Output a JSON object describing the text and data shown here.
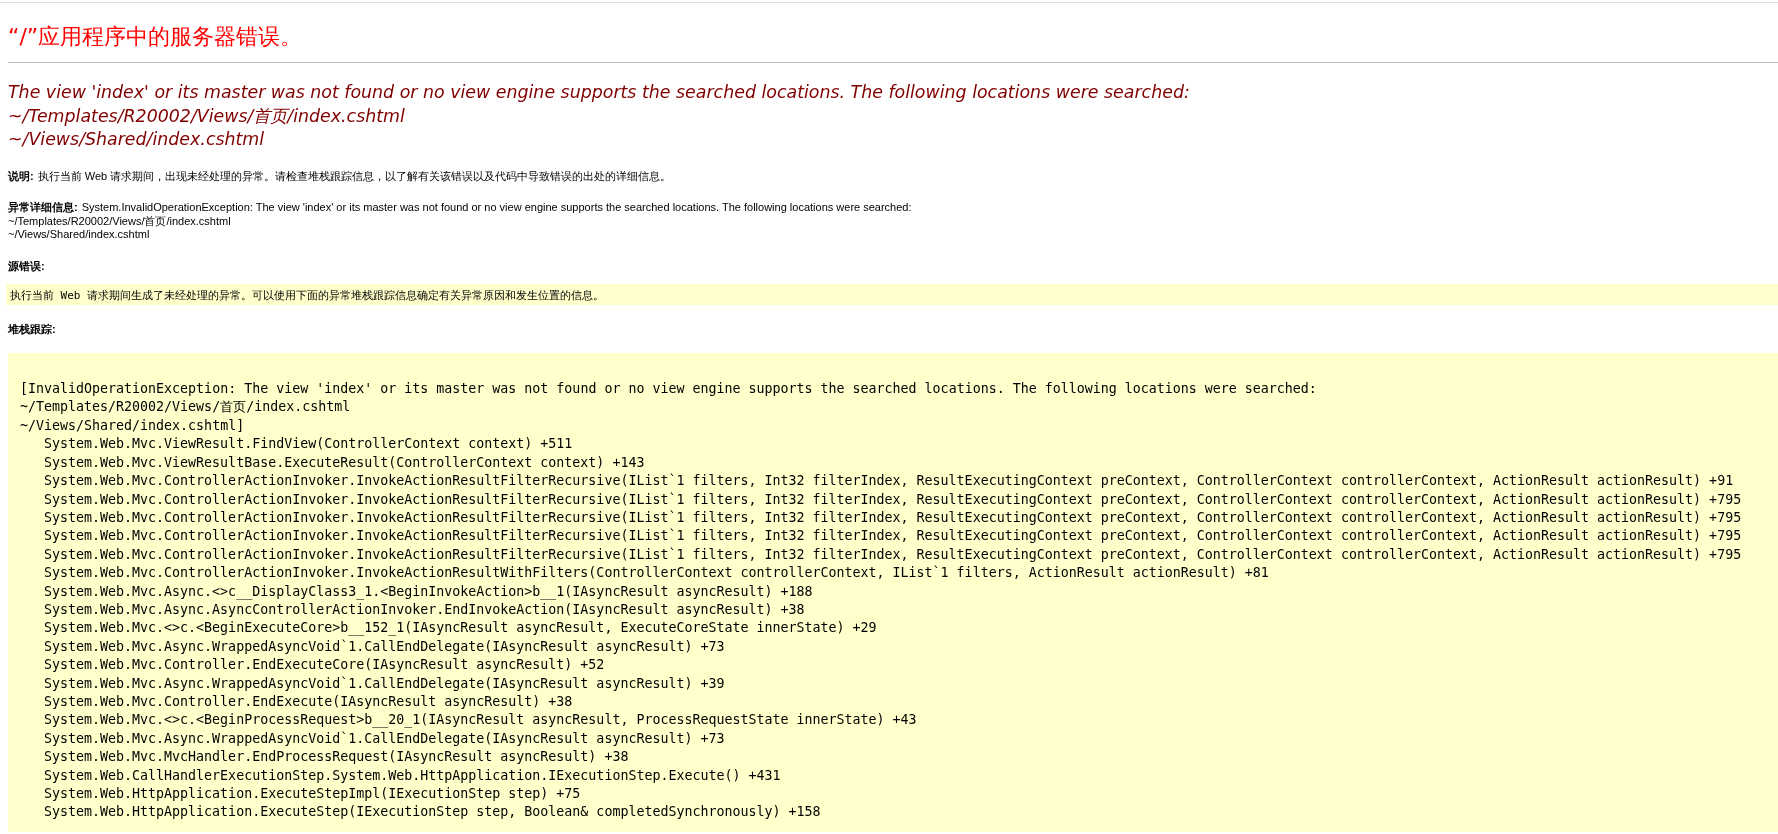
{
  "title": "“/”应用程序中的服务器错误。",
  "error_heading": [
    "The view 'index' or its master was not found or no view engine supports the searched locations. The following locations were searched:",
    "~/Templates/R20002/Views/首页/index.cshtml",
    "~/Views/Shared/index.cshtml"
  ],
  "description": {
    "label": "说明:",
    "text": "执行当前 Web 请求期间，出现未经处理的异常。请检查堆栈跟踪信息，以了解有关该错误以及代码中导致错误的出处的详细信息。"
  },
  "exception_details": {
    "label": "异常详细信息:",
    "lines": [
      "System.InvalidOperationException: The view 'index' or its master was not found or no view engine supports the searched locations. The following locations were searched:",
      "~/Templates/R20002/Views/首页/index.cshtml",
      "~/Views/Shared/index.cshtml"
    ]
  },
  "source_error": {
    "label": "源错误:",
    "text": "执行当前 Web 请求期间生成了未经处理的异常。可以使用下面的异常堆栈跟踪信息确定有关异常原因和发生位置的信息。"
  },
  "stack_trace": {
    "label": "堆栈跟踪:",
    "exception_lines": [
      "[InvalidOperationException: The view 'index' or its master was not found or no view engine supports the searched locations. The following locations were searched:",
      "~/Templates/R20002/Views/首页/index.cshtml",
      "~/Views/Shared/index.cshtml]"
    ],
    "frames": [
      "System.Web.Mvc.ViewResult.FindView(ControllerContext context) +511",
      "System.Web.Mvc.ViewResultBase.ExecuteResult(ControllerContext context) +143",
      "System.Web.Mvc.ControllerActionInvoker.InvokeActionResultFilterRecursive(IList`1 filters, Int32 filterIndex, ResultExecutingContext preContext, ControllerContext controllerContext, ActionResult actionResult) +91",
      "System.Web.Mvc.ControllerActionInvoker.InvokeActionResultFilterRecursive(IList`1 filters, Int32 filterIndex, ResultExecutingContext preContext, ControllerContext controllerContext, ActionResult actionResult) +795",
      "System.Web.Mvc.ControllerActionInvoker.InvokeActionResultFilterRecursive(IList`1 filters, Int32 filterIndex, ResultExecutingContext preContext, ControllerContext controllerContext, ActionResult actionResult) +795",
      "System.Web.Mvc.ControllerActionInvoker.InvokeActionResultFilterRecursive(IList`1 filters, Int32 filterIndex, ResultExecutingContext preContext, ControllerContext controllerContext, ActionResult actionResult) +795",
      "System.Web.Mvc.ControllerActionInvoker.InvokeActionResultFilterRecursive(IList`1 filters, Int32 filterIndex, ResultExecutingContext preContext, ControllerContext controllerContext, ActionResult actionResult) +795",
      "System.Web.Mvc.ControllerActionInvoker.InvokeActionResultWithFilters(ControllerContext controllerContext, IList`1 filters, ActionResult actionResult) +81",
      "System.Web.Mvc.Async.<>c__DisplayClass3_1.<BeginInvokeAction>b__1(IAsyncResult asyncResult) +188",
      "System.Web.Mvc.Async.AsyncControllerActionInvoker.EndInvokeAction(IAsyncResult asyncResult) +38",
      "System.Web.Mvc.<>c.<BeginExecuteCore>b__152_1(IAsyncResult asyncResult, ExecuteCoreState innerState) +29",
      "System.Web.Mvc.Async.WrappedAsyncVoid`1.CallEndDelegate(IAsyncResult asyncResult) +73",
      "System.Web.Mvc.Controller.EndExecuteCore(IAsyncResult asyncResult) +52",
      "System.Web.Mvc.Async.WrappedAsyncVoid`1.CallEndDelegate(IAsyncResult asyncResult) +39",
      "System.Web.Mvc.Controller.EndExecute(IAsyncResult asyncResult) +38",
      "System.Web.Mvc.<>c.<BeginProcessRequest>b__20_1(IAsyncResult asyncResult, ProcessRequestState innerState) +43",
      "System.Web.Mvc.Async.WrappedAsyncVoid`1.CallEndDelegate(IAsyncResult asyncResult) +73",
      "System.Web.Mvc.MvcHandler.EndProcessRequest(IAsyncResult asyncResult) +38",
      "System.Web.CallHandlerExecutionStep.System.Web.HttpApplication.IExecutionStep.Execute() +431",
      "System.Web.HttpApplication.ExecuteStepImpl(IExecutionStep step) +75",
      "System.Web.HttpApplication.ExecuteStep(IExecutionStep step, Boolean& completedSynchronously) +158"
    ]
  }
}
